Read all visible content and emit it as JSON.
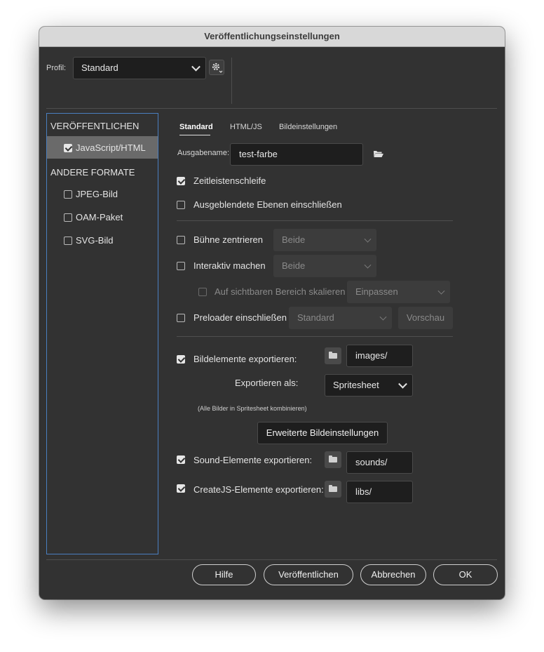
{
  "window": {
    "title": "Veröffentlichungseinstellungen"
  },
  "profile": {
    "label": "Profil:",
    "value": "Standard",
    "gear_icon": "gear-icon"
  },
  "sidebar": {
    "publish_heading": "VERÖFFENTLICHEN",
    "publish_items": [
      {
        "label": "JavaScript/HTML",
        "checked": true,
        "selected": true
      }
    ],
    "other_heading": "ANDERE FORMATE",
    "other_items": [
      {
        "label": "JPEG-Bild",
        "checked": false
      },
      {
        "label": "OAM-Paket",
        "checked": false
      },
      {
        "label": "SVG-Bild",
        "checked": false
      }
    ]
  },
  "tabs": [
    {
      "label": "Standard",
      "active": true
    },
    {
      "label": "HTML/JS",
      "active": false
    },
    {
      "label": "Bildeinstellungen",
      "active": false
    }
  ],
  "output": {
    "label": "Ausgabename:",
    "value": "test-farbe",
    "folder_icon": "folder-open-icon"
  },
  "options": {
    "timeline_loop": {
      "label": "Zeitleistenschleife",
      "checked": true
    },
    "hidden_layers": {
      "label": "Ausgeblendete Ebenen einschließen",
      "checked": false
    },
    "center_stage": {
      "label": "Bühne zentrieren",
      "checked": false,
      "select": "Beide"
    },
    "responsive": {
      "label": "Interaktiv machen",
      "checked": false,
      "select": "Beide"
    },
    "scale_visible": {
      "label": "Auf sichtbaren Bereich skalieren",
      "checked": false,
      "select": "Einpassen"
    },
    "preloader": {
      "label": "Preloader einschließen",
      "checked": false,
      "select": "Standard",
      "preview": "Vorschau"
    }
  },
  "export": {
    "images": {
      "label": "Bildelemente exportieren:",
      "checked": true,
      "path": "images/"
    },
    "export_as_label": "Exportieren als:",
    "export_as_value": "Spritesheet",
    "note": "(Alle Bilder in Spritesheet kombinieren)",
    "advanced_button": "Erweiterte Bildeinstellungen",
    "sounds": {
      "label": "Sound-Elemente exportieren:",
      "checked": true,
      "path": "sounds/"
    },
    "createjs": {
      "label": "CreateJS-Elemente exportieren:",
      "checked": true,
      "path": "libs/"
    }
  },
  "footer": {
    "help": "Hilfe",
    "publish": "Veröffentlichen",
    "cancel": "Abbrechen",
    "ok": "OK"
  },
  "colors": {
    "dialog_bg": "#323232",
    "field_bg": "#1e1e1e",
    "sidebar_border": "#4a7fc0",
    "selection_bg": "#6a6a6a"
  }
}
